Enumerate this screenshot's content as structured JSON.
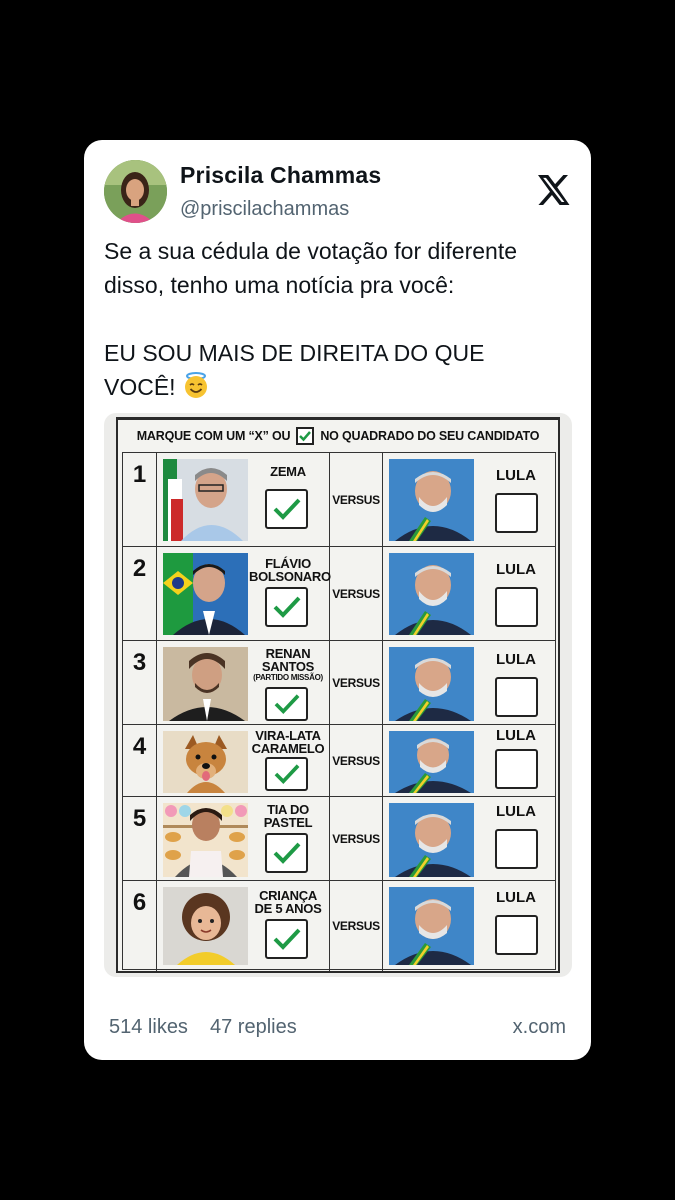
{
  "post": {
    "author_name": "Priscila Chammas",
    "author_handle": "@priscilachammas",
    "text_line1": "Se a sua cédula de votação for diferente",
    "text_line2": "disso, tenho uma notícia pra você:",
    "text_line3": "EU SOU MAIS DE DIREITA DO QUE",
    "text_line4": "VOCÊ!",
    "emoji": "smiling-face-with-halo"
  },
  "ballot": {
    "header_left": "MARQUE COM UM “X” OU",
    "header_right": "NO QUADRADO DO SEU CANDIDATO",
    "versus": "VERSUS",
    "opponent": "LULA",
    "rows": [
      {
        "num": "1",
        "name": "ZEMA",
        "sub": "",
        "checked": true
      },
      {
        "num": "2",
        "name": "FLÁVIO BOLSONARO",
        "sub": "",
        "checked": true
      },
      {
        "num": "3",
        "name": "RENAN SANTOS",
        "sub": "(PARTIDO MISSÃO)",
        "checked": true
      },
      {
        "num": "4",
        "name": "VIRA-LATA CARAMELO",
        "sub": "",
        "checked": true
      },
      {
        "num": "5",
        "name": "TIA DO PASTEL",
        "sub": "",
        "checked": true
      },
      {
        "num": "6",
        "name": "CRIANÇA DE 5 ANOS",
        "sub": "",
        "checked": true
      }
    ]
  },
  "footer": {
    "likes": "514 likes",
    "replies": "47 replies",
    "domain": "x.com"
  },
  "colors": {
    "check_green": "#1e9a45",
    "handle_gray": "#536471",
    "background": "#000000"
  }
}
